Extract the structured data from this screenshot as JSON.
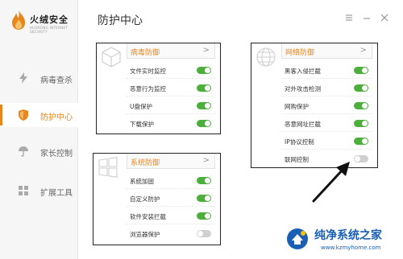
{
  "app": {
    "name": "火绒安全",
    "subtitle": "HUORONG INTERNET SECURITY"
  },
  "header": {
    "title": "防护中心"
  },
  "sidebar": {
    "items": [
      {
        "label": "病毒查杀",
        "icon": "lightning-icon",
        "active": false
      },
      {
        "label": "防护中心",
        "icon": "shield-icon",
        "active": true
      },
      {
        "label": "家长控制",
        "icon": "umbrella-icon",
        "active": false
      },
      {
        "label": "扩展工具",
        "icon": "grid-icon",
        "active": false
      }
    ]
  },
  "panels": {
    "virus": {
      "title": "病毒防御",
      "rows": [
        {
          "label": "文件实时监控",
          "on": true
        },
        {
          "label": "恶意行为监控",
          "on": true
        },
        {
          "label": "U盘保护",
          "on": true
        },
        {
          "label": "下载保护",
          "on": true
        }
      ]
    },
    "system": {
      "title": "系统防御",
      "rows": [
        {
          "label": "系统加固",
          "on": true
        },
        {
          "label": "自定义防护",
          "on": true
        },
        {
          "label": "软件安装拦截",
          "on": true
        },
        {
          "label": "浏览器保护",
          "on": false
        }
      ]
    },
    "network": {
      "title": "网络防御",
      "rows": [
        {
          "label": "黑客入侵拦截",
          "on": true
        },
        {
          "label": "对外攻击检测",
          "on": true
        },
        {
          "label": "网购保护",
          "on": true
        },
        {
          "label": "恶意网址拦截",
          "on": true
        },
        {
          "label": "IP协议控制",
          "on": true
        },
        {
          "label": "联网控制",
          "on": false
        }
      ]
    }
  },
  "watermark": {
    "name": "纯净系统之家",
    "url": "www.kzmyhome.com"
  },
  "colors": {
    "accent": "#e8861c",
    "toggle_on": "#4caf3c",
    "toggle_off": "#cfcfcf",
    "watermark": "#1a5fb4"
  }
}
